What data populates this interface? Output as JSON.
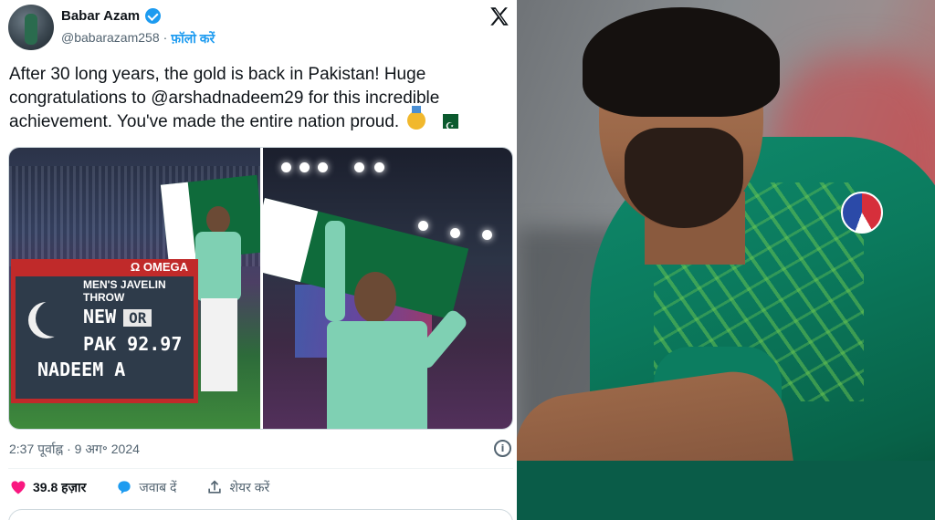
{
  "tweet": {
    "author_name": "Babar Azam",
    "handle": "@babarazam258",
    "separator": "·",
    "follow_label": "फ़ॉलो करें",
    "text": "After 30 long years, the gold is back in Pakistan! Huge congratulations to @arshadnadeem29 for this incredible achievement. You've made the entire nation proud.",
    "timestamp": "2:37 पूर्वाह्न · 9 अग॰ 2024",
    "info_icon_label": "i",
    "actions": {
      "likes": "39.8 हज़ार",
      "reply_label": "जवाब दें",
      "share_label": "शेयर करें"
    },
    "scoreboard": {
      "brand": "Ω OMEGA",
      "event": "MEN'S JAVELIN THROW",
      "line1": "NEW",
      "record_tag": "OR",
      "line2": "PAK 92.97",
      "line3": "NADEEM A"
    }
  },
  "icons": {
    "verified": "verified-badge-icon",
    "x_logo": "x-logo-icon",
    "heart": "heart-icon",
    "reply": "reply-icon",
    "share": "share-icon",
    "info": "info-icon",
    "medal": "gold-medal-emoji",
    "flag": "pakistan-flag-emoji"
  },
  "colors": {
    "accent": "#1d9bf0",
    "heart": "#f91880",
    "text": "#0f1419",
    "secondary": "#536471"
  }
}
